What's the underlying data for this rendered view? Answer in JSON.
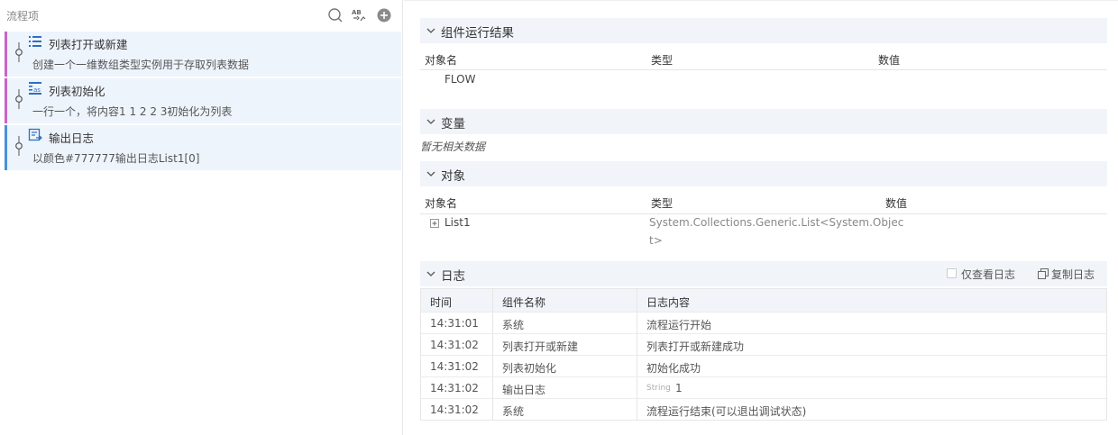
{
  "sidebar": {
    "title": "流程项",
    "items": [
      {
        "title": "列表打开或新建",
        "desc": "创建一个一维数组类型实例用于存取列表数据",
        "bar_color": "#c965c9"
      },
      {
        "title": "列表初始化",
        "desc": "一行一个，将内容1 1 2 2 3初始化为列表",
        "bar_color": "#c965c9"
      },
      {
        "title": "输出日志",
        "desc": "以颜色#777777输出日志List1[0]",
        "bar_color": "#4a90d9"
      }
    ]
  },
  "result_section": {
    "title": "组件运行结果",
    "columns": [
      "对象名",
      "类型",
      "数值"
    ],
    "rows": [
      [
        "FLOW",
        "",
        ""
      ]
    ]
  },
  "variable_section": {
    "title": "变量",
    "empty_text": "暂无相关数据"
  },
  "object_section": {
    "title": "对象",
    "columns": [
      "对象名",
      "类型",
      "数值"
    ],
    "rows": [
      {
        "name": "List1",
        "type_line1": "System.Collections.Generic.List<System.Objec",
        "type_line2": "t>",
        "value": ""
      }
    ]
  },
  "log_section": {
    "title": "日志",
    "only_log_label": "仅查看日志",
    "copy_log_label": "复制日志",
    "columns": [
      "时间",
      "组件名称",
      "日志内容"
    ],
    "rows": [
      {
        "time": "14:31:01",
        "component": "系统",
        "content": "流程运行开始",
        "tag": ""
      },
      {
        "time": "14:31:02",
        "component": "列表打开或新建",
        "content": "列表打开或新建成功",
        "tag": ""
      },
      {
        "time": "14:31:02",
        "component": "列表初始化",
        "content": "初始化成功",
        "tag": ""
      },
      {
        "time": "14:31:02",
        "component": "输出日志",
        "content": "1",
        "tag": "String"
      },
      {
        "time": "14:31:02",
        "component": "系统",
        "content": "流程运行结束(可以退出调试状态)",
        "tag": ""
      }
    ]
  },
  "colors": {
    "accent": "#4a90d9",
    "item_bg": "#eef4fc",
    "section_bg": "#f1f5fa",
    "purple_bar": "#c965c9"
  }
}
